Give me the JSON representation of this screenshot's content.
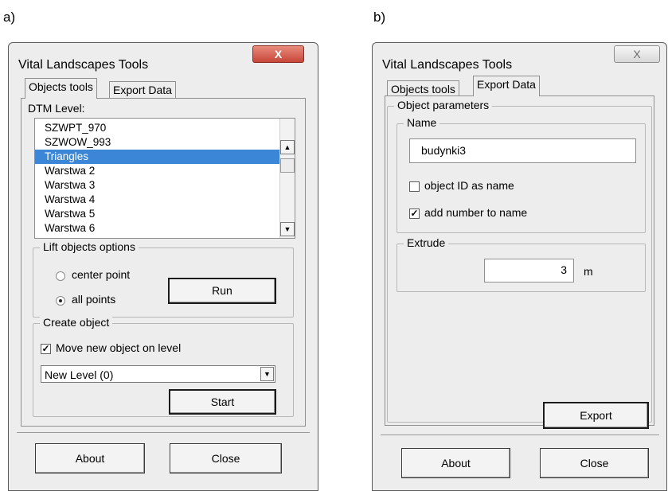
{
  "panel_a": {
    "label": "a)",
    "window": {
      "title": "Vital Landscapes Tools",
      "close_glyph": "X",
      "tabs": [
        {
          "label": "Objects tools",
          "active": true
        },
        {
          "label": "Export Data",
          "active": false
        }
      ],
      "dtm_label": "DTM Level:",
      "levels": [
        "SZWPT_970",
        "SZWOW_993",
        "Triangles",
        "Warstwa 2",
        "Warstwa 3",
        "Warstwa 4",
        "Warstwa 5",
        "Warstwa 6"
      ],
      "selected_level": "Triangles",
      "scroll_up": "▲",
      "scroll_down": "▼",
      "lift": {
        "group_label": "Lift objects options",
        "opt_center": "center point",
        "opt_all": "all points",
        "selected": "all points",
        "run_label": "Run"
      },
      "create": {
        "group_label": "Create object",
        "move_label": "Move new object on level",
        "move_checked": true,
        "combo_value": "New Level (0)",
        "combo_arrow": "▼",
        "start_label": "Start"
      },
      "about_label": "About",
      "close_label": "Close"
    }
  },
  "panel_b": {
    "label": "b)",
    "window": {
      "title": "Vital Landscapes Tools",
      "close_glyph": "X",
      "tabs": [
        {
          "label": "Objects tools",
          "active": false
        },
        {
          "label": "Export Data",
          "active": true
        }
      ],
      "params_label": "Object parameters",
      "name": {
        "group_label": "Name",
        "value": "budynki3",
        "id_as_name_label": "object ID as name",
        "id_as_name_checked": false,
        "add_number_label": "add number to name",
        "add_number_checked": true
      },
      "extrude": {
        "group_label": "Extrude",
        "value": "3",
        "unit": "m"
      },
      "export_label": "Export",
      "about_label": "About",
      "close_label": "Close"
    }
  },
  "check_glyph": "✓"
}
